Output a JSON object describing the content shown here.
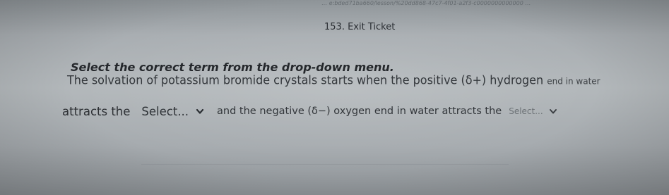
{
  "browser": {
    "url": "… e:bded71ba660/lesson/%20dd868-47c7-4f01-a2f3-c0000000000000 …"
  },
  "page": {
    "title": "153. Exit Ticket"
  },
  "question": {
    "instruction": "Select the correct term from the drop-down menu.",
    "sentence_part_1": "The solvation of potassium bromide crystals starts when the positive (δ+) hydrogen",
    "sentence_part_1_tail": "end in water",
    "sentence_part_2": "attracts the",
    "dropdown_1": {
      "label": "Select...",
      "icon": "chevron-down-icon"
    },
    "sentence_part_3": "and the negative (δ−) oxygen end in water attracts the",
    "dropdown_2": {
      "label": "Select...",
      "icon": "chevron-down-icon"
    }
  }
}
